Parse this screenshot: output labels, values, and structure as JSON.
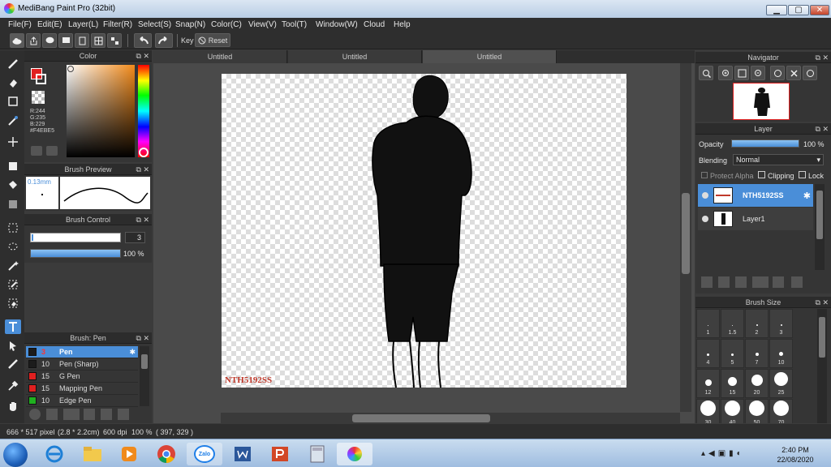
{
  "window": {
    "title": "MediBang Paint Pro (32bit)",
    "min_label": "▁",
    "max_label": "▢",
    "close_label": "✕"
  },
  "menu": [
    "File(F)",
    "Edit(E)",
    "Layer(L)",
    "Filter(R)",
    "Select(S)",
    "Snap(N)",
    "Color(C)",
    "View(V)",
    "Tool(T)",
    "Window(W)",
    "Cloud",
    "Help"
  ],
  "toolbar": {
    "key_label": "Key",
    "reset_label": "Reset"
  },
  "color_panel": {
    "title": "Color",
    "rgb": [
      "R:244",
      "G:235",
      "B:229",
      "#F4EBE5"
    ]
  },
  "brush_preview": {
    "title": "Brush Preview",
    "size": "0.13mm"
  },
  "brush_control": {
    "title": "Brush Control",
    "size_value": "3",
    "opacity_value": "100 %",
    "opacity_level": 1.0
  },
  "brush_list": {
    "title": "Brush: Pen",
    "items": [
      {
        "size": "3",
        "name": "Pen",
        "color": "#1c1c1c"
      },
      {
        "size": "10",
        "name": "Pen (Sharp)",
        "color": "#1c1c1c"
      },
      {
        "size": "15",
        "name": "G Pen",
        "color": "#e02020"
      },
      {
        "size": "15",
        "name": "Mapping Pen",
        "color": "#e02020"
      },
      {
        "size": "10",
        "name": "Edge Pen",
        "color": "#20b020"
      }
    ]
  },
  "tabs": [
    "Untitled",
    "Untitled",
    "Untitled"
  ],
  "canvas": {
    "watermark": "NTH5192SS"
  },
  "navigator": {
    "title": "Navigator"
  },
  "layer_panel": {
    "title": "Layer",
    "opacity_label": "Opacity",
    "opacity_value": "100 %",
    "opacity_level": 1.0,
    "blending_label": "Blending",
    "blending_value": "Normal",
    "protect_alpha": "Protect Alpha",
    "clipping": "Clipping",
    "lock": "Lock",
    "layers": [
      {
        "name": "NTH5192SS"
      },
      {
        "name": "Layer1"
      }
    ]
  },
  "brush_size": {
    "title": "Brush Size",
    "sizes": [
      "1",
      "1.5",
      "2",
      "3",
      "4",
      "5",
      "7",
      "10",
      "12",
      "15",
      "20",
      "25",
      "30",
      "40",
      "50",
      "70"
    ]
  },
  "status": {
    "dimensions": "666 * 517 pixel",
    "physical": "(2.8 * 2.2cm)",
    "dpi": "600 dpi",
    "zoom": "100 %",
    "coords": "( 397, 329 )"
  },
  "taskbar": {
    "zalo": "Zalo",
    "time": "2:40 PM",
    "date": "22/08/2020"
  }
}
